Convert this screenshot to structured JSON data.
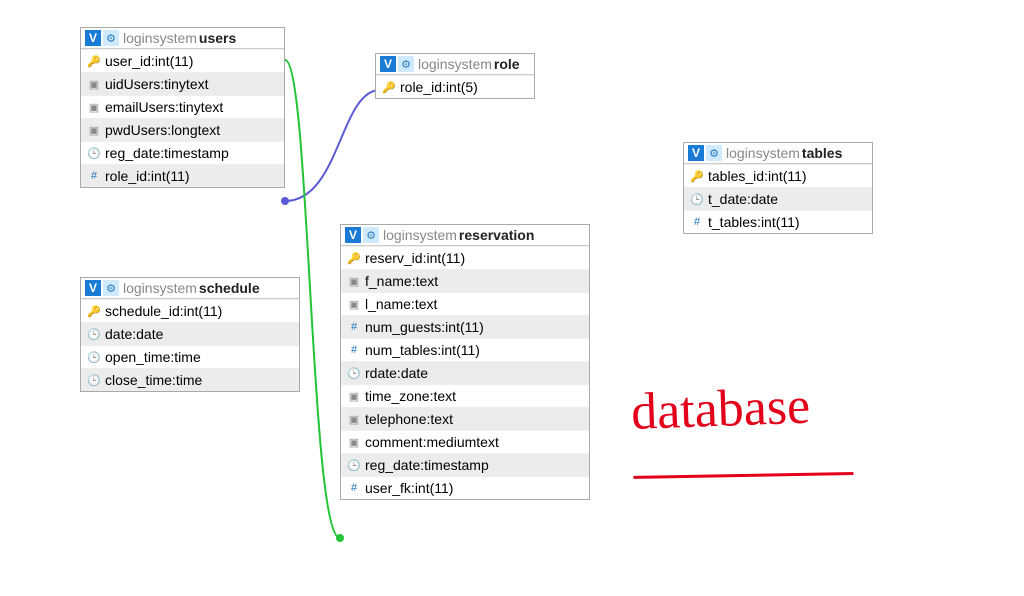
{
  "db": "loginsystem",
  "annotation": "database",
  "tables": {
    "users": {
      "pos": [
        80,
        27,
        205
      ],
      "name": "users",
      "cols": [
        {
          "name": "user_id",
          "type": "int(11)",
          "icon": "key",
          "alt": false
        },
        {
          "name": "uidUsers",
          "type": "tinytext",
          "icon": "text",
          "alt": true
        },
        {
          "name": "emailUsers",
          "type": "tinytext",
          "icon": "text",
          "alt": false
        },
        {
          "name": "pwdUsers",
          "type": "longtext",
          "icon": "text",
          "alt": true
        },
        {
          "name": "reg_date",
          "type": "timestamp",
          "icon": "clock",
          "alt": false
        },
        {
          "name": "role_id",
          "type": "int(11)",
          "icon": "hash",
          "alt": true
        }
      ]
    },
    "role": {
      "pos": [
        375,
        53,
        160
      ],
      "name": "role",
      "cols": [
        {
          "name": "role_id",
          "type": "int(5)",
          "icon": "key",
          "alt": false
        }
      ]
    },
    "tables": {
      "pos": [
        683,
        142,
        190
      ],
      "name": "tables",
      "cols": [
        {
          "name": "tables_id",
          "type": "int(11)",
          "icon": "key",
          "alt": false
        },
        {
          "name": "t_date",
          "type": "date",
          "icon": "clock",
          "alt": true
        },
        {
          "name": "t_tables",
          "type": "int(11)",
          "icon": "hash",
          "alt": false
        }
      ]
    },
    "schedule": {
      "pos": [
        80,
        277,
        220
      ],
      "name": "schedule",
      "cols": [
        {
          "name": "schedule_id",
          "type": "int(11)",
          "icon": "key",
          "alt": false
        },
        {
          "name": "date",
          "type": "date",
          "icon": "clock",
          "alt": true
        },
        {
          "name": "open_time",
          "type": "time",
          "icon": "clock",
          "alt": false
        },
        {
          "name": "close_time",
          "type": "time",
          "icon": "clock",
          "alt": true
        }
      ]
    },
    "reservation": {
      "pos": [
        340,
        224,
        250
      ],
      "name": "reservation",
      "cols": [
        {
          "name": "reserv_id",
          "type": "int(11)",
          "icon": "key",
          "alt": false
        },
        {
          "name": "f_name",
          "type": "text",
          "icon": "text",
          "alt": true
        },
        {
          "name": "l_name",
          "type": "text",
          "icon": "text",
          "alt": false
        },
        {
          "name": "num_guests",
          "type": "int(11)",
          "icon": "hash",
          "alt": true
        },
        {
          "name": "num_tables",
          "type": "int(11)",
          "icon": "hash",
          "alt": false
        },
        {
          "name": "rdate",
          "type": "date",
          "icon": "clock",
          "alt": true
        },
        {
          "name": "time_zone",
          "type": "text",
          "icon": "text",
          "alt": false
        },
        {
          "name": "telephone",
          "type": "text",
          "icon": "text",
          "alt": true
        },
        {
          "name": "comment",
          "type": "mediumtext",
          "icon": "text",
          "alt": false
        },
        {
          "name": "reg_date",
          "type": "timestamp",
          "icon": "clock",
          "alt": true
        },
        {
          "name": "user_fk",
          "type": "int(11)",
          "icon": "hash",
          "alt": false
        }
      ]
    }
  },
  "relations": [
    {
      "from": "users.role_id",
      "to": "role.role_id",
      "color": "#5b5bd6"
    },
    {
      "from": "reservation.user_fk",
      "to": "users.user_id",
      "color": "#22c536"
    }
  ]
}
